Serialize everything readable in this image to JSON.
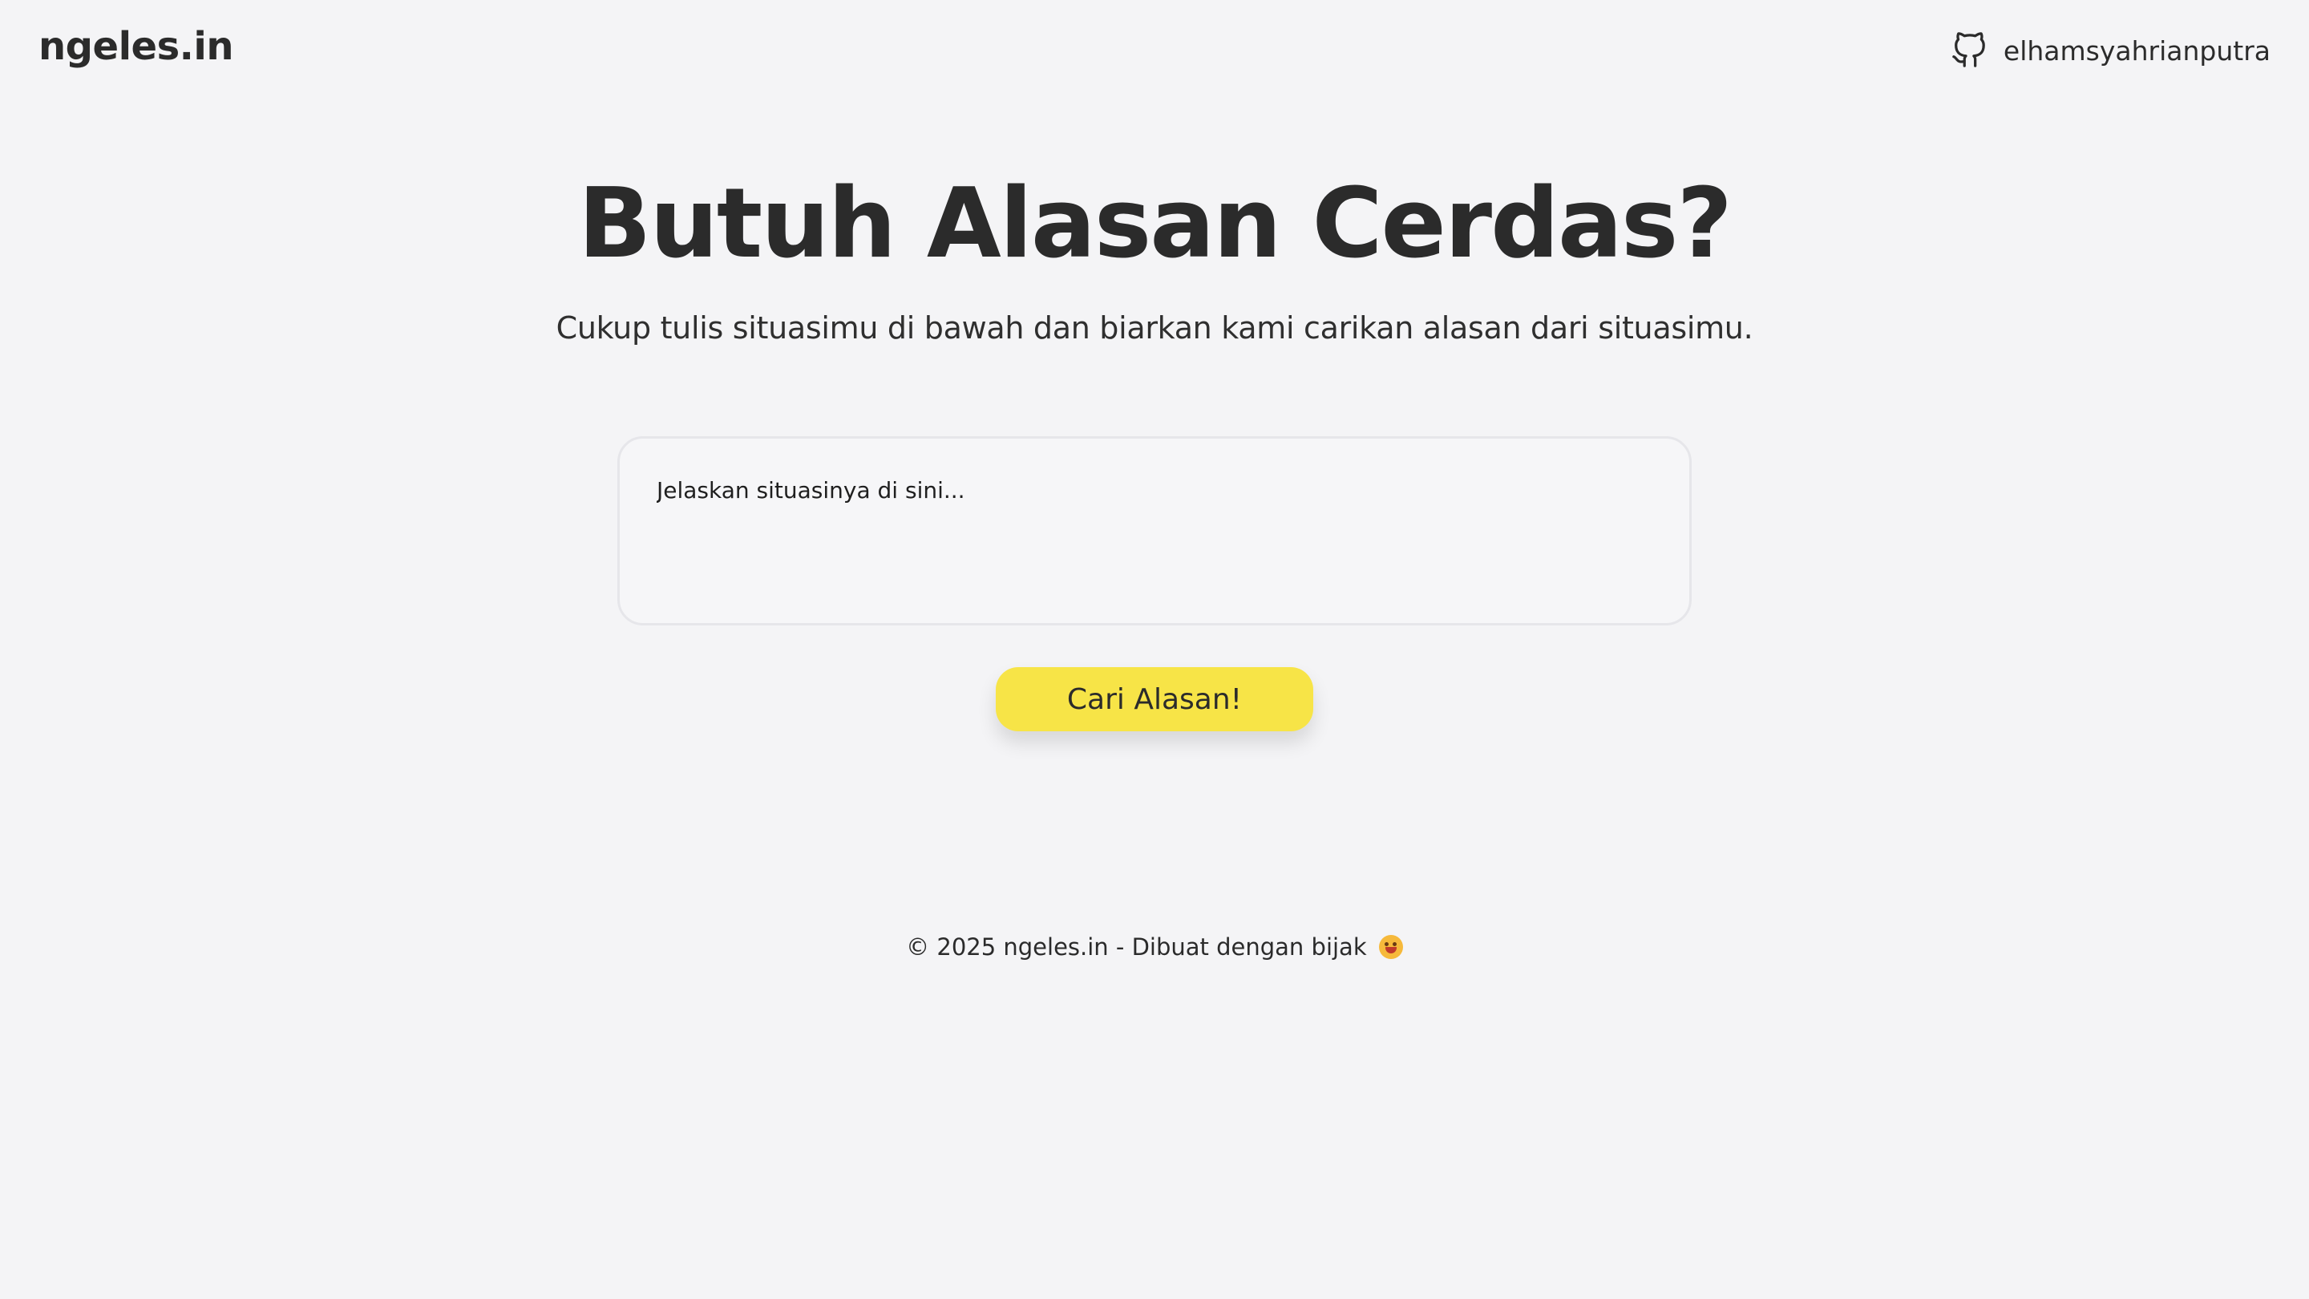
{
  "header": {
    "logo": "ngeles.in",
    "github": {
      "icon": "github-icon",
      "username": "elhamsyahrianputra"
    }
  },
  "hero": {
    "title": "Butuh Alasan Cerdas?",
    "subtitle": "Cukup tulis situasimu di bawah dan biarkan kami carikan alasan dari situasimu."
  },
  "form": {
    "input_placeholder": "Jelaskan situasinya di sini...",
    "input_value": "",
    "submit_label": "Cari Alasan!"
  },
  "footer": {
    "text": "© 2025 ngeles.in - Dibuat dengan bijak",
    "emoji": "grinning-face-emoji"
  },
  "colors": {
    "background": "#f4f4f6",
    "accent": "#f7e447",
    "text": "#2b2b2b"
  }
}
